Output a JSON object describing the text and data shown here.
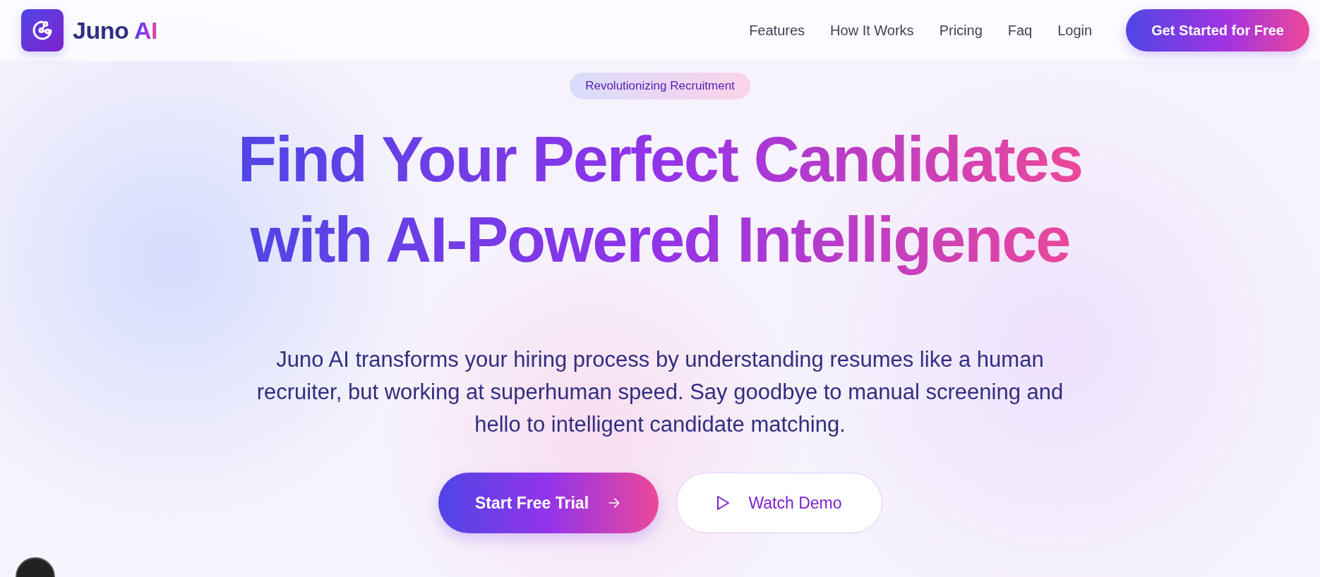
{
  "brand": {
    "name": "Juno",
    "accent": "AI"
  },
  "nav": {
    "links": [
      {
        "label": "Features"
      },
      {
        "label": "How It Works"
      },
      {
        "label": "Pricing"
      },
      {
        "label": "Faq"
      },
      {
        "label": "Login"
      }
    ],
    "cta": "Get Started for Free"
  },
  "hero": {
    "badge": "Revolutionizing Recruitment",
    "title_lines": [
      "Find Your Perfect Candidates",
      "with AI-Powered Intelligence"
    ],
    "description": "Juno AI transforms your hiring process by understanding resumes like a human recruiter, but working at superhuman speed. Say goodbye to manual screening and hello to intelligent candidate matching.",
    "buttons": [
      {
        "kind": "primary",
        "label": "Start Free Trial"
      },
      {
        "kind": "secondary",
        "label": "Watch Demo"
      }
    ]
  }
}
